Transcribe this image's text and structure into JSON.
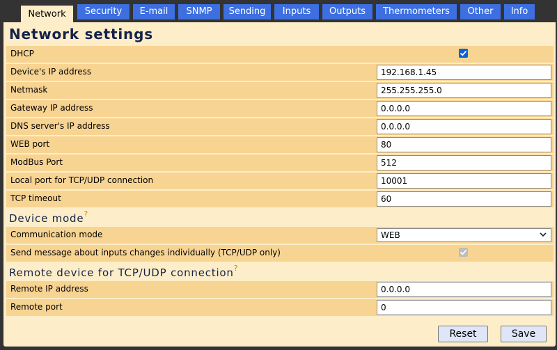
{
  "tabs": [
    {
      "label": "Network",
      "active": true
    },
    {
      "label": "Security"
    },
    {
      "label": "E-mail"
    },
    {
      "label": "SNMP"
    },
    {
      "label": "Sending"
    },
    {
      "label": "Inputs"
    },
    {
      "label": "Outputs"
    },
    {
      "label": "Thermometers"
    },
    {
      "label": "Other"
    },
    {
      "label": "Info"
    }
  ],
  "page_title": "Network settings",
  "network": {
    "dhcp": {
      "label": "DHCP",
      "checked": true
    },
    "ip": {
      "label": "Device's IP address",
      "value": "192.168.1.45"
    },
    "netmask": {
      "label": "Netmask",
      "value": "255.255.255.0"
    },
    "gateway": {
      "label": "Gateway IP address",
      "value": "0.0.0.0"
    },
    "dns": {
      "label": "DNS server's IP address",
      "value": "0.0.0.0"
    },
    "web_port": {
      "label": "WEB port",
      "value": "80"
    },
    "modbus_port": {
      "label": "ModBus Port",
      "value": "512"
    },
    "local_port": {
      "label": "Local port for TCP/UDP connection",
      "value": "10001"
    },
    "tcp_timeout": {
      "label": "TCP timeout",
      "value": "60"
    }
  },
  "device_mode": {
    "title": "Device mode",
    "help_mark": "?",
    "communication_mode": {
      "label": "Communication mode",
      "value": "WEB"
    },
    "send_individually": {
      "label": "Send message about inputs changes individually (TCP/UDP only)",
      "checked": true,
      "disabled": true
    }
  },
  "remote": {
    "title": "Remote device for TCP/UDP connection",
    "help_mark": "?",
    "ip": {
      "label": "Remote IP address",
      "value": "0.0.0.0"
    },
    "port": {
      "label": "Remote port",
      "value": "0"
    }
  },
  "buttons": {
    "reset": "Reset",
    "save": "Save"
  },
  "colors": {
    "tab_bg": "#3d6fe0",
    "panel_bg": "#fdeec9",
    "row_bg": "#f8d493",
    "title_color": "#14224a",
    "help_color": "#d08c00",
    "checkbox_on": "#0b62d6"
  }
}
